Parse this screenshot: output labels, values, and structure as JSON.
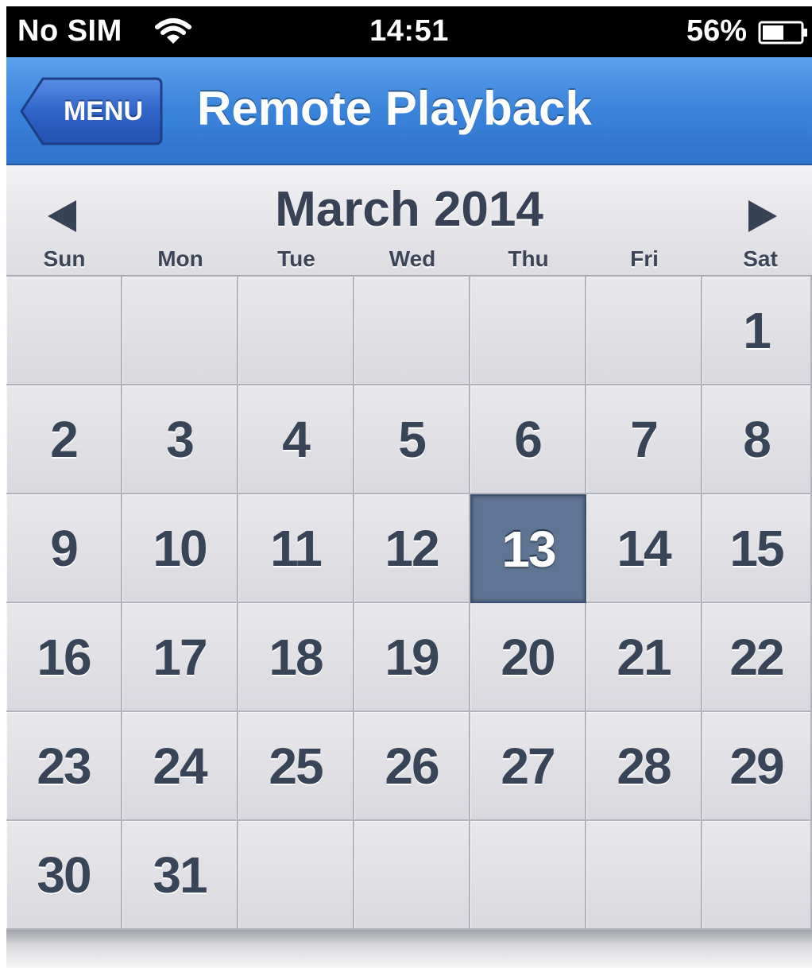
{
  "status_bar": {
    "carrier": "No SIM",
    "time": "14:51",
    "battery_percent": "56%",
    "battery_level": 0.56,
    "icons": [
      "wifi-icon",
      "battery-icon"
    ]
  },
  "nav": {
    "back_label": "MENU",
    "title": "Remote Playback"
  },
  "calendar": {
    "month_title": "March 2014",
    "prev_icon": "left-triangle-icon",
    "next_icon": "right-triangle-icon",
    "weekdays": [
      "Sun",
      "Mon",
      "Tue",
      "Wed",
      "Thu",
      "Fri",
      "Sat"
    ],
    "first_weekday_index": 6,
    "days_in_month": 31,
    "selected_day": "13"
  },
  "colors": {
    "nav_bar": "#3a83db",
    "selected_day_bg": "#5f7594",
    "day_text": "#384458"
  }
}
